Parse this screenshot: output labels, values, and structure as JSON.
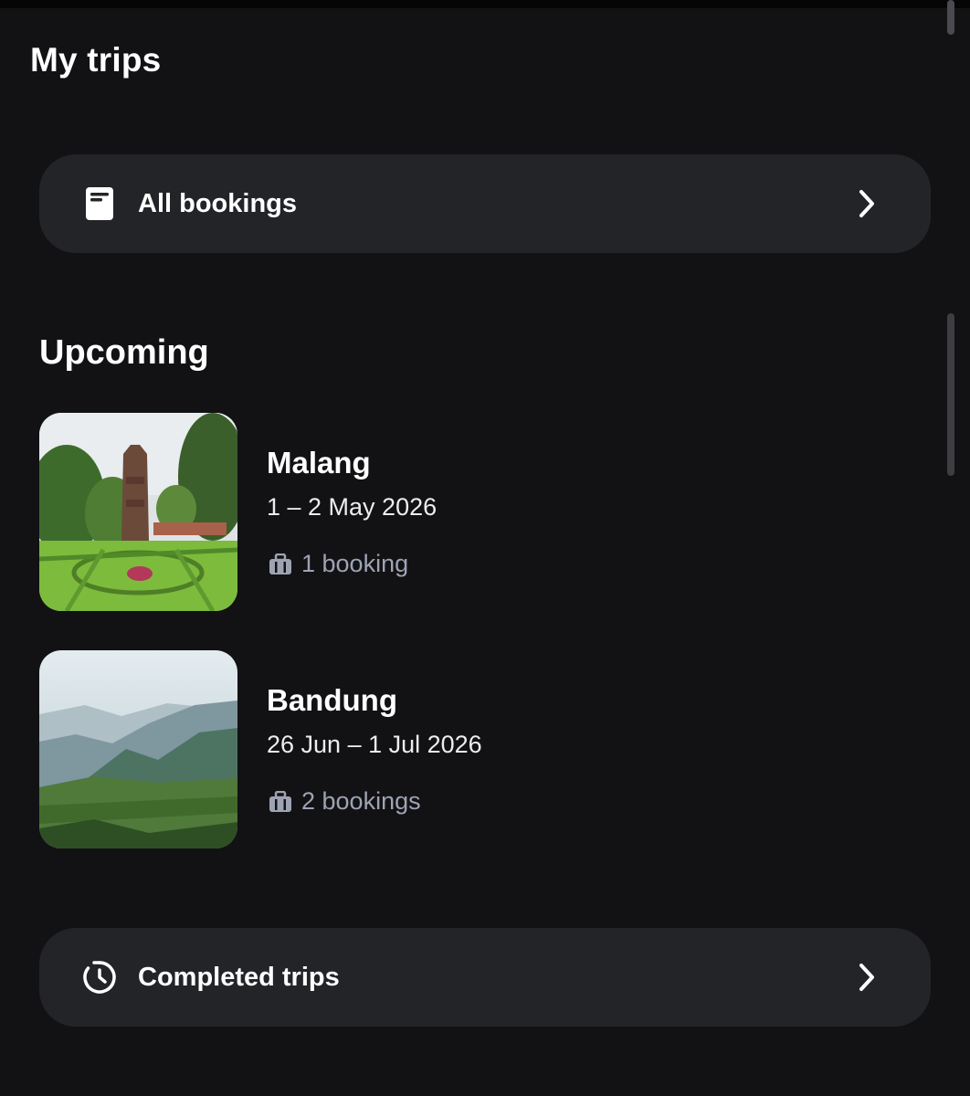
{
  "header": {
    "title": "My trips"
  },
  "all_bookings": {
    "label": "All bookings",
    "icon": "booking-document-icon"
  },
  "upcoming": {
    "title": "Upcoming",
    "trips": [
      {
        "city": "Malang",
        "dates": "1 – 2 May 2026",
        "bookings": "1 booking",
        "image": "temple-garden-photo"
      },
      {
        "city": "Bandung",
        "dates": "26 Jun – 1 Jul 2026",
        "bookings": "2 bookings",
        "image": "misty-mountains-photo"
      }
    ]
  },
  "completed": {
    "label": "Completed trips",
    "icon": "history-clock-icon"
  },
  "colors": {
    "background": "#121214",
    "card": "#232428",
    "muted_text": "#9ea3b4"
  }
}
